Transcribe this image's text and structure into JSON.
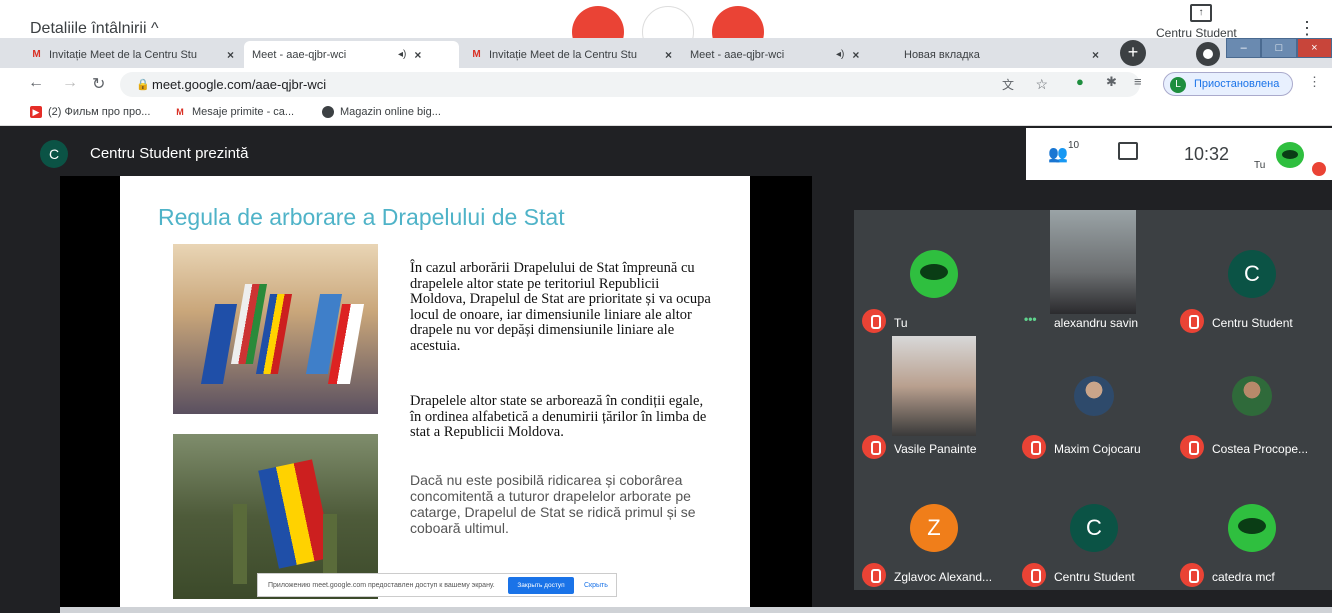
{
  "meet_top": {
    "details": "Detaliile întâlnirii  ^",
    "present_label": "Centru Student"
  },
  "tabs": [
    {
      "title": "Invitație Meet de la Centru Stu",
      "icon": "gmail-icon"
    },
    {
      "title": "Meet - aae-qjbr-wci",
      "icon": "meet-icon",
      "speaker": "◂)"
    },
    {
      "title": "Invitație Meet de la Centru Stu",
      "icon": "gmail-icon"
    },
    {
      "title": "Meet - aae-qjbr-wci",
      "icon": "meet-icon",
      "speaker": "◂)"
    },
    {
      "title": "Новая вкладка",
      "icon": ""
    }
  ],
  "address": {
    "url": "meet.google.com/aae-qjbr-wci",
    "profile_status": "Приостановлена",
    "profile_initial": "L"
  },
  "bookmarks": [
    {
      "label": "(2) Фильм про про...",
      "icon": "youtube-icon",
      "color": "#e52d27"
    },
    {
      "label": "Mesaje primite - ca...",
      "icon": "gmail-icon",
      "color": "#d93025"
    },
    {
      "label": "Magazin online big...",
      "icon": "globe-icon",
      "color": "#3c4043"
    }
  ],
  "meet": {
    "presenter_initial": "C",
    "presenter_title": "Centru Student prezintă",
    "people_count": "10",
    "time": "10:32",
    "you_label": "Tu"
  },
  "slide": {
    "title": "Regula de arborare a Drapelului de Stat",
    "p1": "În cazul arborării Drapelului de Stat împreună cu drapelele altor state pe teritoriul Republicii Moldova, Drapelul de Stat are prioritate și va ocupa locul de onoare, iar dimensiunile liniare ale altor drapele nu vor depăși dimensiunile liniare ale acestuia.",
    "p2": "Drapelele altor state se arborează în condiții egale, în ordinea alfabetică a denumirii țărilor în limba de stat a Republicii Moldova.",
    "p3": "Dacă nu este posibilă ridicarea și coborârea concomitentă a tuturor drapelelor arborate pe catarge, Drapelul de Stat se ridică primul și se coboară ultimul.",
    "notice_text": "Приложению meet.google.com предоставлен доступ к вашему экрану.",
    "notice_button": "Закрыть доступ",
    "notice_hide": "Скрыть"
  },
  "participants": [
    {
      "name": "Tu",
      "initial": "",
      "type": "green"
    },
    {
      "name": "alexandru savin",
      "initial": "",
      "type": "video"
    },
    {
      "name": "Centru Student",
      "initial": "C",
      "type": "teal"
    },
    {
      "name": "Vasile Panainte",
      "initial": "",
      "type": "video"
    },
    {
      "name": "Maxim Cojocaru",
      "initial": "",
      "type": "photo"
    },
    {
      "name": "Costea Procope...",
      "initial": "",
      "type": "photo"
    },
    {
      "name": "Zglavoc Alexand...",
      "initial": "Z",
      "type": "orange"
    },
    {
      "name": "Centru Student",
      "initial": "C",
      "type": "teal"
    },
    {
      "name": "catedra mcf",
      "initial": "",
      "type": "green"
    }
  ]
}
